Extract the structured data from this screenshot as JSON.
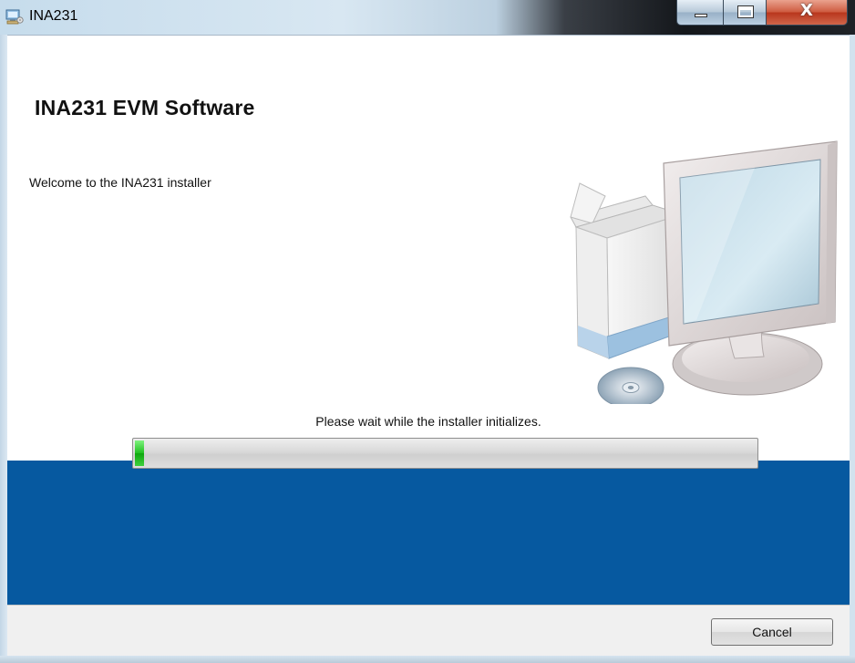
{
  "window": {
    "title": "INA231",
    "icon": "installer-icon",
    "caption_buttons": {
      "minimize_icon": "minimize-icon",
      "maximize_icon": "maximize-icon",
      "close_icon": "close-icon",
      "close_glyph": "X"
    }
  },
  "installer": {
    "heading": "INA231 EVM Software",
    "welcome_text": "Welcome to the INA231 installer",
    "illustration": "computer-with-box-and-cd-icon",
    "status_text": "Please wait while the installer initializes.",
    "progress": 0.015,
    "band_color": "#0659a0",
    "progress_color": "#1fbf1f"
  },
  "footer": {
    "cancel_label": "Cancel"
  }
}
